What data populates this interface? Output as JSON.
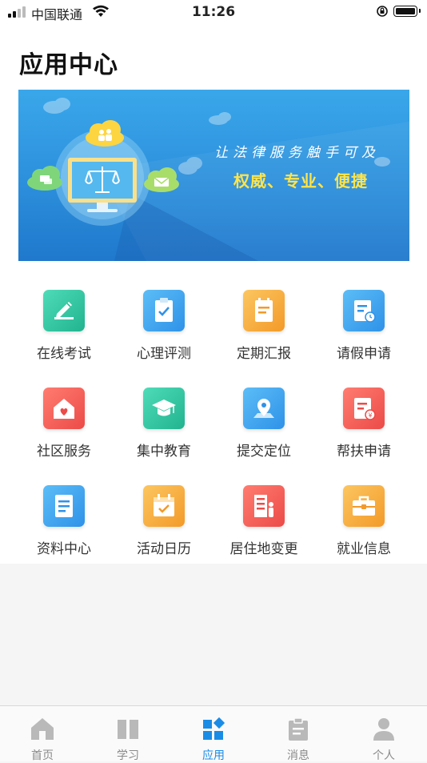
{
  "status_bar": {
    "carrier": "中国联通",
    "time": "11:26"
  },
  "page_title": "应用中心",
  "banner": {
    "slogan": "让法律服务触手可及",
    "tagline": "权威、专业、便捷"
  },
  "apps": [
    {
      "label": "在线考试",
      "icon": "pencil-icon",
      "color": "#2ec6a4"
    },
    {
      "label": "心理评测",
      "icon": "clipboard-check-icon",
      "color": "#3fa6f2"
    },
    {
      "label": "定期汇报",
      "icon": "report-icon",
      "color": "#f6a93b"
    },
    {
      "label": "请假申请",
      "icon": "leave-form-icon",
      "color": "#3fa6f2"
    },
    {
      "label": "社区服务",
      "icon": "community-house-icon",
      "color": "#f45b55"
    },
    {
      "label": "集中教育",
      "icon": "graduation-cap-icon",
      "color": "#2ec6a4"
    },
    {
      "label": "提交定位",
      "icon": "location-pin-icon",
      "color": "#3fa6f2"
    },
    {
      "label": "帮扶申请",
      "icon": "aid-form-icon",
      "color": "#f45b55"
    },
    {
      "label": "资料中心",
      "icon": "document-icon",
      "color": "#3fa6f2"
    },
    {
      "label": "活动日历",
      "icon": "calendar-icon",
      "color": "#f6a93b"
    },
    {
      "label": "居住地变更",
      "icon": "building-person-icon",
      "color": "#f45b55"
    },
    {
      "label": "就业信息",
      "icon": "briefcase-icon",
      "color": "#f6a93b"
    }
  ],
  "tabs": [
    {
      "label": "首页",
      "icon": "home-icon",
      "active": false
    },
    {
      "label": "学习",
      "icon": "book-icon",
      "active": false
    },
    {
      "label": "应用",
      "icon": "apps-grid-icon",
      "active": true
    },
    {
      "label": "消息",
      "icon": "clipboard-icon",
      "active": false
    },
    {
      "label": "个人",
      "icon": "person-icon",
      "active": false
    }
  ],
  "colors": {
    "accent": "#1a8ce6",
    "tagline": "#ffe44a"
  }
}
